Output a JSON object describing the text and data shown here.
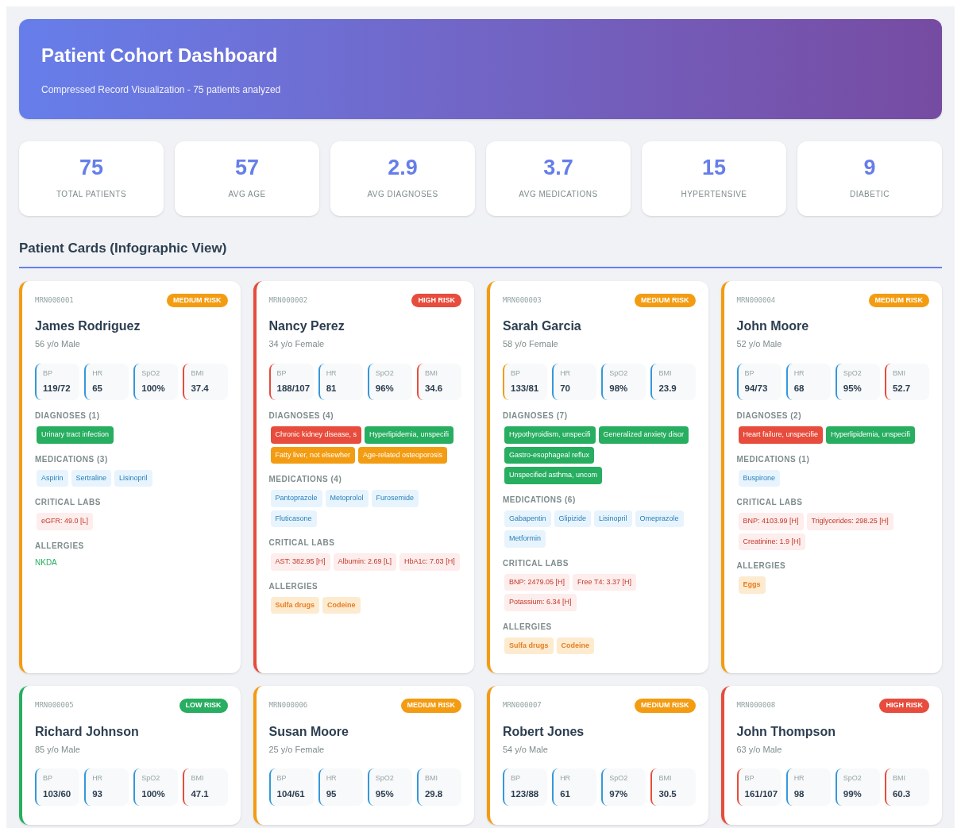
{
  "header": {
    "title": "Patient Cohort Dashboard",
    "subtitle": "Compressed Record Visualization - 75 patients analyzed"
  },
  "stats": [
    {
      "value": "75",
      "label": "TOTAL PATIENTS"
    },
    {
      "value": "57",
      "label": "AVG AGE"
    },
    {
      "value": "2.9",
      "label": "AVG DIAGNOSES"
    },
    {
      "value": "3.7",
      "label": "AVG MEDICATIONS"
    },
    {
      "value": "15",
      "label": "HYPERTENSIVE"
    },
    {
      "value": "9",
      "label": "DIABETIC"
    }
  ],
  "section_title": "Patient Cards (Infographic View)",
  "patients": [
    {
      "mrn": "MRN000001",
      "risk": "MEDIUM RISK",
      "kind": "medium",
      "name": "James Rodriguez",
      "demographics": "56 y/o Male",
      "vitals": [
        {
          "label": "BP",
          "value": "119/72",
          "kind": "normal"
        },
        {
          "label": "HR",
          "value": "65",
          "kind": "normal"
        },
        {
          "label": "SpO2",
          "value": "100%",
          "kind": "normal"
        },
        {
          "label": "BMI",
          "value": "37.4",
          "kind": "critical"
        }
      ],
      "diagnoses_title": "DIAGNOSES (1)",
      "diagnoses": [
        {
          "text": "Urinary tract infection",
          "color": "#27ae60"
        }
      ],
      "medications_title": "MEDICATIONS (3)",
      "medications": [
        "Aspirin",
        "Sertraline",
        "Lisinopril"
      ],
      "labs_title": "CRITICAL LABS",
      "labs": [
        "eGFR: 49.0 [L]"
      ],
      "allergies_title": "ALLERGIES",
      "nkda": "NKDA"
    },
    {
      "mrn": "MRN000002",
      "risk": "HIGH RISK",
      "kind": "high",
      "name": "Nancy Perez",
      "demographics": "34 y/o Female",
      "vitals": [
        {
          "label": "BP",
          "value": "188/107",
          "kind": "critical"
        },
        {
          "label": "HR",
          "value": "81",
          "kind": "normal"
        },
        {
          "label": "SpO2",
          "value": "96%",
          "kind": "normal"
        },
        {
          "label": "BMI",
          "value": "34.6",
          "kind": "critical"
        }
      ],
      "diagnoses_title": "DIAGNOSES (4)",
      "diagnoses": [
        {
          "text": "Chronic kidney disease, s",
          "color": "#e74c3c"
        },
        {
          "text": "Hyperlipidemia, unspecifi",
          "color": "#27ae60"
        },
        {
          "text": "Fatty liver, not elsewher",
          "color": "#f39c12"
        },
        {
          "text": "Age-related osteoporosis",
          "color": "#f39c12"
        }
      ],
      "medications_title": "MEDICATIONS (4)",
      "medications": [
        "Pantoprazole",
        "Metoprolol",
        "Furosemide",
        "Fluticasone"
      ],
      "labs_title": "CRITICAL LABS",
      "labs": [
        "AST: 382.95 [H]",
        "Albumin: 2.69 [L]",
        "HbA1c: 7.03 [H]"
      ],
      "allergies_title": "ALLERGIES",
      "allergies": [
        "Sulfa drugs",
        "Codeine"
      ]
    },
    {
      "mrn": "MRN000003",
      "risk": "MEDIUM RISK",
      "kind": "medium",
      "name": "Sarah Garcia",
      "demographics": "58 y/o Female",
      "vitals": [
        {
          "label": "BP",
          "value": "133/81",
          "kind": "warning"
        },
        {
          "label": "HR",
          "value": "70",
          "kind": "normal"
        },
        {
          "label": "SpO2",
          "value": "98%",
          "kind": "normal"
        },
        {
          "label": "BMI",
          "value": "23.9",
          "kind": "normal"
        }
      ],
      "diagnoses_title": "DIAGNOSES (7)",
      "diagnoses": [
        {
          "text": "Hypothyroidism, unspecifi",
          "color": "#27ae60"
        },
        {
          "text": "Generalized anxiety disor",
          "color": "#27ae60"
        },
        {
          "text": "Gastro-esophageal reflux",
          "color": "#27ae60"
        },
        {
          "text": "Unspecified asthma, uncom",
          "color": "#27ae60"
        }
      ],
      "medications_title": "MEDICATIONS (6)",
      "medications": [
        "Gabapentin",
        "Glipizide",
        "Lisinopril",
        "Omeprazole",
        "Metformin"
      ],
      "labs_title": "CRITICAL LABS",
      "labs": [
        "BNP: 2479.05 [H]",
        "Free T4: 3.37 [H]",
        "Potassium: 6.34 [H]"
      ],
      "allergies_title": "ALLERGIES",
      "allergies": [
        "Sulfa drugs",
        "Codeine"
      ]
    },
    {
      "mrn": "MRN000004",
      "risk": "MEDIUM RISK",
      "kind": "medium",
      "name": "John Moore",
      "demographics": "52 y/o Male",
      "vitals": [
        {
          "label": "BP",
          "value": "94/73",
          "kind": "normal"
        },
        {
          "label": "HR",
          "value": "68",
          "kind": "normal"
        },
        {
          "label": "SpO2",
          "value": "95%",
          "kind": "normal"
        },
        {
          "label": "BMI",
          "value": "52.7",
          "kind": "critical"
        }
      ],
      "diagnoses_title": "DIAGNOSES (2)",
      "diagnoses": [
        {
          "text": "Heart failure, unspecifie",
          "color": "#e74c3c"
        },
        {
          "text": "Hyperlipidemia, unspecifi",
          "color": "#27ae60"
        }
      ],
      "medications_title": "MEDICATIONS (1)",
      "medications": [
        "Buspirone"
      ],
      "labs_title": "CRITICAL LABS",
      "labs": [
        "BNP: 4103.99 [H]",
        "Triglycerides: 298.25 [H]",
        "Creatinine: 1.9 [H]"
      ],
      "allergies_title": "ALLERGIES",
      "allergies": [
        "Eggs"
      ]
    },
    {
      "mrn": "MRN000005",
      "risk": "LOW RISK",
      "kind": "low",
      "name": "Richard Johnson",
      "demographics": "85 y/o Male",
      "vitals": [
        {
          "label": "BP",
          "value": "103/60",
          "kind": "normal"
        },
        {
          "label": "HR",
          "value": "93",
          "kind": "normal"
        },
        {
          "label": "SpO2",
          "value": "100%",
          "kind": "normal"
        },
        {
          "label": "BMI",
          "value": "47.1",
          "kind": "critical"
        }
      ]
    },
    {
      "mrn": "MRN000006",
      "risk": "MEDIUM RISK",
      "kind": "medium",
      "name": "Susan Moore",
      "demographics": "25 y/o Female",
      "vitals": [
        {
          "label": "BP",
          "value": "104/61",
          "kind": "normal"
        },
        {
          "label": "HR",
          "value": "95",
          "kind": "normal"
        },
        {
          "label": "SpO2",
          "value": "95%",
          "kind": "normal"
        },
        {
          "label": "BMI",
          "value": "29.8",
          "kind": "normal"
        }
      ]
    },
    {
      "mrn": "MRN000007",
      "risk": "MEDIUM RISK",
      "kind": "medium",
      "name": "Robert Jones",
      "demographics": "54 y/o Male",
      "vitals": [
        {
          "label": "BP",
          "value": "123/88",
          "kind": "normal"
        },
        {
          "label": "HR",
          "value": "61",
          "kind": "normal"
        },
        {
          "label": "SpO2",
          "value": "97%",
          "kind": "normal"
        },
        {
          "label": "BMI",
          "value": "30.5",
          "kind": "critical"
        }
      ]
    },
    {
      "mrn": "MRN000008",
      "risk": "HIGH RISK",
      "kind": "high",
      "name": "John Thompson",
      "demographics": "63 y/o Male",
      "vitals": [
        {
          "label": "BP",
          "value": "161/107",
          "kind": "critical"
        },
        {
          "label": "HR",
          "value": "98",
          "kind": "normal"
        },
        {
          "label": "SpO2",
          "value": "99%",
          "kind": "normal"
        },
        {
          "label": "BMI",
          "value": "60.3",
          "kind": "critical"
        }
      ]
    }
  ]
}
